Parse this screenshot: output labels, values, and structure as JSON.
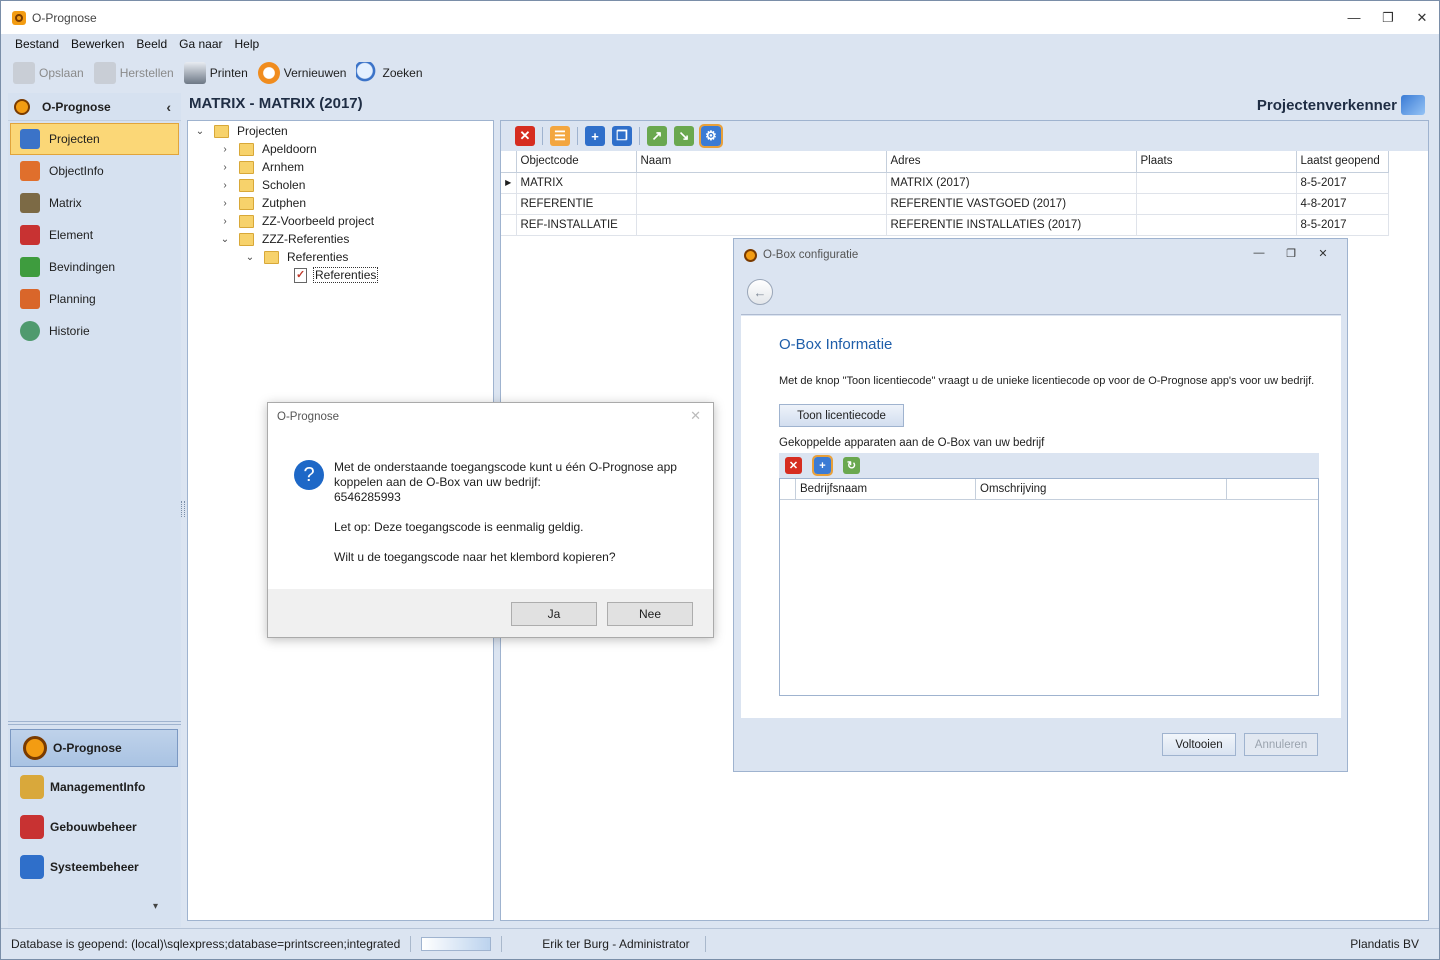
{
  "window": {
    "title": "O-Prognose"
  },
  "menu": [
    "Bestand",
    "Bewerken",
    "Beeld",
    "Ga naar",
    "Help"
  ],
  "toolbar": {
    "save": "Opslaan",
    "restore": "Herstellen",
    "print": "Printen",
    "refresh": "Vernieuwen",
    "search": "Zoeken"
  },
  "nav": {
    "header": "O-Prognose",
    "items": [
      {
        "label": "Projecten",
        "icon": "projects-icon",
        "color": "#3b73c8"
      },
      {
        "label": "ObjectInfo",
        "icon": "house-icon",
        "color": "#e06f2c"
      },
      {
        "label": "Matrix",
        "icon": "matrix-folder-icon",
        "color": "#7c6a45"
      },
      {
        "label": "Element",
        "icon": "element-folder-icon",
        "color": "#c83232"
      },
      {
        "label": "Bevindingen",
        "icon": "findings-folder-icon",
        "color": "#3e9c3e"
      },
      {
        "label": "Planning",
        "icon": "calendar-icon",
        "color": "#d9662a"
      },
      {
        "label": "Historie",
        "icon": "history-icon",
        "color": "#4f9a6e"
      }
    ],
    "modules": [
      {
        "label": "O-Prognose",
        "icon": "oprognose-logo-icon",
        "color": "#f39c12"
      },
      {
        "label": "ManagementInfo",
        "icon": "management-folder-icon",
        "color": "#d9a83b"
      },
      {
        "label": "Gebouwbeheer",
        "icon": "building-folder-icon",
        "color": "#c83232"
      },
      {
        "label": "Systeembeheer",
        "icon": "system-gear-icon",
        "color": "#2f6fca"
      }
    ]
  },
  "main": {
    "title": "MATRIX - MATRIX (2017)",
    "explorer": "Projectenverkenner"
  },
  "tree": {
    "root": "Projecten",
    "children": [
      "Apeldoorn",
      "Arnhem",
      "Scholen",
      "Zutphen",
      "ZZ-Voorbeeld project",
      "ZZZ-Referenties"
    ],
    "sub_folder": "Referenties",
    "leaf": "Referenties"
  },
  "grid": {
    "columns": [
      "Objectcode",
      "Naam",
      "Adres",
      "Plaats",
      "Laatst geopend"
    ],
    "rows": [
      [
        "MATRIX",
        "",
        "MATRIX (2017)",
        "",
        "8-5-2017"
      ],
      [
        "REFERENTIE",
        "",
        "REFERENTIE VASTGOED (2017)",
        "",
        "4-8-2017"
      ],
      [
        "REF-INSTALLATIE",
        "",
        "REFERENTIE INSTALLATIES (2017)",
        "",
        "8-5-2017"
      ]
    ]
  },
  "obox": {
    "title": "O-Box configuratie",
    "heading": "O-Box Informatie",
    "description": "Met de knop \"Toon licentiecode\" vraagt u de unieke licentiecode op voor de O-Prognose app's voor uw bedrijf.",
    "license_button": "Toon licentiecode",
    "linked_label": "Gekoppelde apparaten aan de O-Box van uw bedrijf",
    "columns": [
      "Bedrijfsnaam",
      "Omschrijving"
    ],
    "finish": "Voltooien",
    "cancel": "Annuleren"
  },
  "message": {
    "title": "O-Prognose",
    "line1": "Met de onderstaande toegangscode kunt u één O-Prognose app koppelen aan de O-Box van uw bedrijf:",
    "code": "6546285993",
    "line2": "Let op: Deze toegangscode is eenmalig geldig.",
    "line3": "Wilt u de toegangscode naar het klembord kopieren?",
    "yes": "Ja",
    "no": "Nee"
  },
  "status": {
    "database": "Database is geopend: (local)\\sqlexpress;database=printscreen;integrated",
    "user": "Erik ter Burg - Administrator",
    "company": "Plandatis BV"
  }
}
